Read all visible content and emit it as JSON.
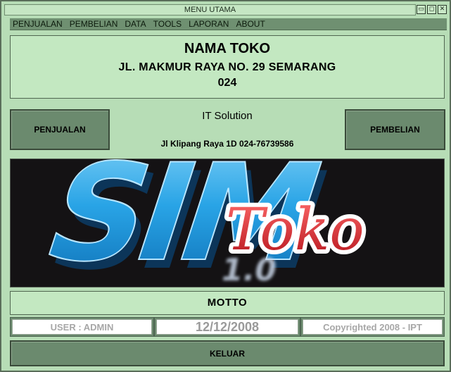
{
  "window": {
    "title": "MENU UTAMA",
    "buttons": {
      "minimize": "▭",
      "maximize": "◻",
      "close": "✕"
    }
  },
  "menu": [
    "PENJUALAN",
    "PEMBELIAN",
    "DATA",
    "TOOLS",
    "LAPORAN",
    "ABOUT"
  ],
  "header": {
    "store_name": "NAMA TOKO",
    "address": "JL. MAKMUR RAYA NO. 29 SEMARANG",
    "phone": "024"
  },
  "actions": {
    "penjualan": "PENJUALAN",
    "pembelian": "PEMBELIAN",
    "keluar": "KELUAR"
  },
  "vendor": {
    "name": "IT Solution",
    "address": "Jl Klipang Raya 1D 024-76739586"
  },
  "logo": {
    "primary_text": "SIM",
    "secondary_text": "Toko",
    "reflection_text": "1.0",
    "colors": {
      "primary": "#1e9be0",
      "secondary": "#d9262a",
      "background": "#141214"
    }
  },
  "motto": "MOTTO",
  "status": {
    "user": "USER : ADMIN",
    "date": "12/12/2008",
    "copyright": "Copyrighted 2008 - IPT"
  }
}
